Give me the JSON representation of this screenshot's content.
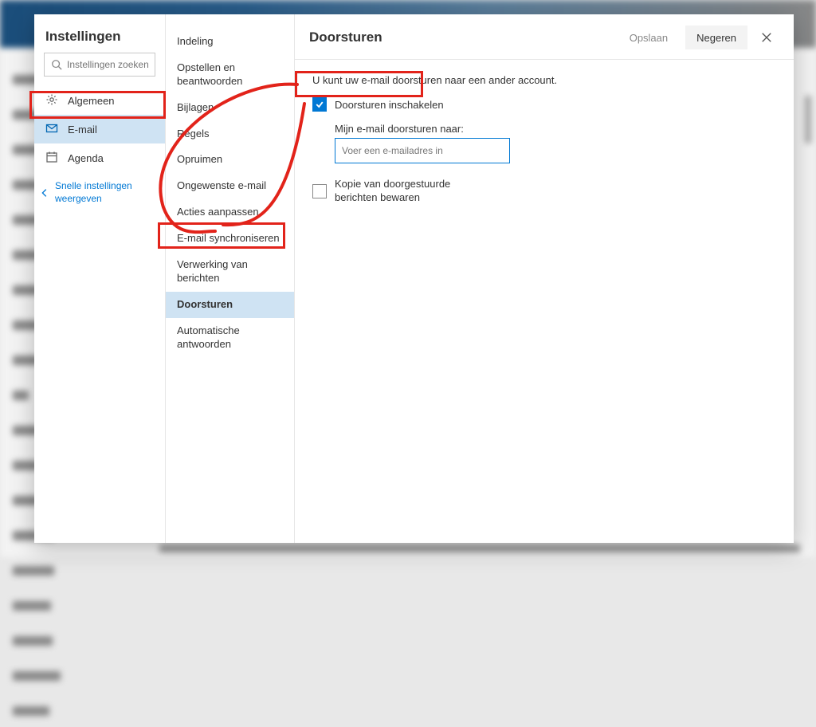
{
  "col1": {
    "title": "Instellingen",
    "search_placeholder": "Instellingen zoeken",
    "items": [
      {
        "icon": "gear",
        "label": "Algemeen"
      },
      {
        "icon": "mail",
        "label": "E-mail"
      },
      {
        "icon": "calendar",
        "label": "Agenda"
      }
    ],
    "selected_index": 1,
    "quick_label": "Snelle instellingen weergeven"
  },
  "col2": {
    "items": [
      "Indeling",
      "Opstellen en beantwoorden",
      "Bijlagen",
      "Regels",
      "Opruimen",
      "Ongewenste e-mail",
      "Acties aanpassen",
      "E-mail synchroniseren",
      "Verwerking van berichten",
      "Doorsturen",
      "Automatische antwoorden"
    ],
    "selected_index": 9
  },
  "col3": {
    "title": "Doorsturen",
    "save_label": "Opslaan",
    "discard_label": "Negeren",
    "intro": "U kunt uw e-mail doorsturen naar een ander account.",
    "enable_label": "Doorsturen inschakelen",
    "enable_checked": true,
    "forward_to_label": "Mijn e-mail doorsturen naar:",
    "forward_placeholder": "Voer een e-mailadres in",
    "forward_value": "",
    "keep_copy_label": "Kopie van doorgestuurde berichten bewaren",
    "keep_copy_checked": false
  }
}
